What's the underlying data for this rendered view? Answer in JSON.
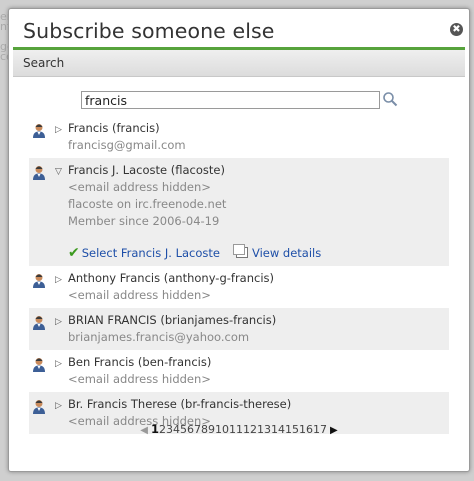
{
  "dialog": {
    "title": "Subscribe someone else",
    "close_glyph": "✖",
    "search_label": "Search",
    "query": "francis"
  },
  "results": [
    {
      "name": "Francis (francis)",
      "lines": [
        "francisg@gmail.com"
      ],
      "expanded": false,
      "shaded": false
    },
    {
      "name": "Francis J. Lacoste (flacoste)",
      "lines": [
        "<email address hidden>",
        "flacoste on irc.freenode.net",
        "Member since 2006-04-19"
      ],
      "expanded": true,
      "shaded": true,
      "select_label": "Select Francis J. Lacoste",
      "details_label": "View details"
    },
    {
      "name": "Anthony Francis (anthony-g-francis)",
      "lines": [
        "<email address hidden>"
      ],
      "expanded": false,
      "shaded": false
    },
    {
      "name": "BRIAN FRANCIS (brianjames-francis)",
      "lines": [
        "brianjames.francis@yahoo.com"
      ],
      "expanded": false,
      "shaded": true
    },
    {
      "name": "Ben Francis (ben-francis)",
      "lines": [
        "<email address hidden>"
      ],
      "expanded": false,
      "shaded": false
    },
    {
      "name": "Br. Francis Therese (br-francis-therese)",
      "lines": [
        "<email address hidden>"
      ],
      "expanded": false,
      "shaded": true
    }
  ],
  "pagination": {
    "current": "1",
    "pages": [
      "2",
      "3",
      "4",
      "5",
      "6",
      "7",
      "8",
      "9",
      "10",
      "11",
      "12",
      "13",
      "14",
      "15",
      "16",
      "17"
    ]
  }
}
